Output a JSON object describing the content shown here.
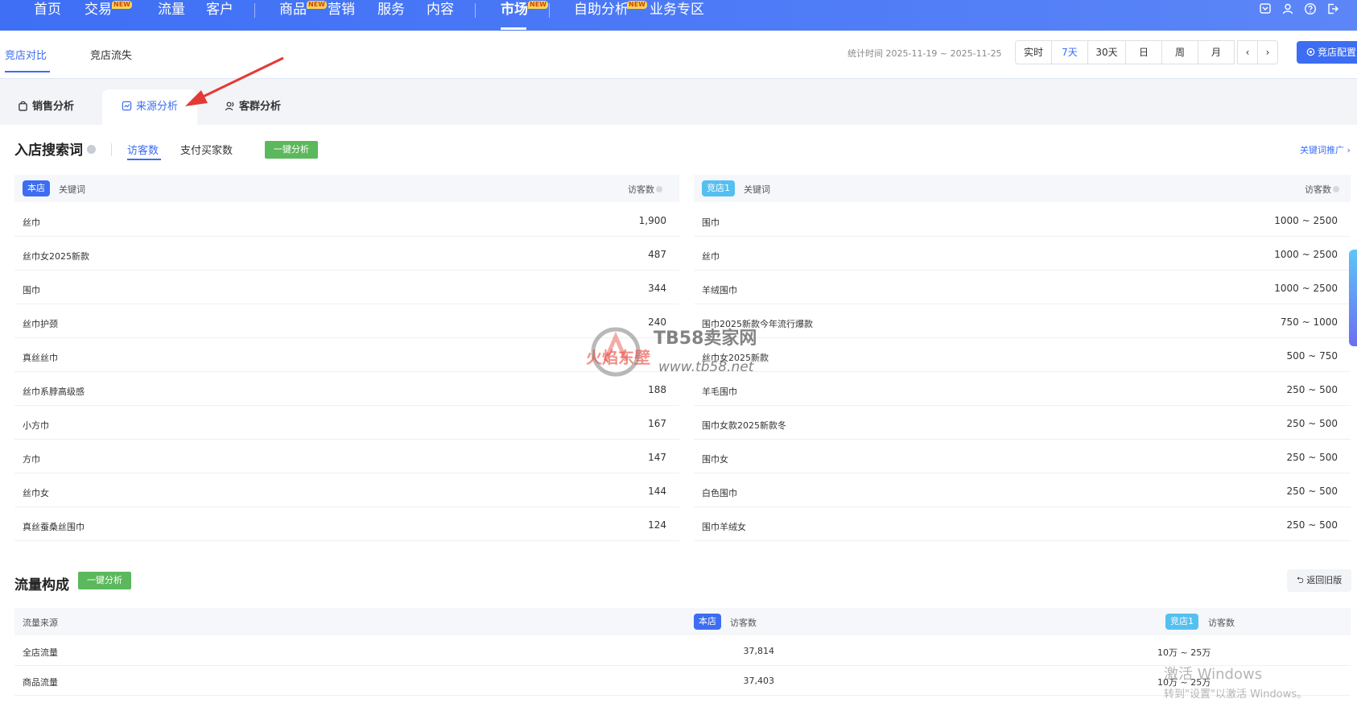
{
  "nav": {
    "items": [
      {
        "label": "首页",
        "new": false
      },
      {
        "label": "交易",
        "new": true
      },
      {
        "label": "流量",
        "new": false
      },
      {
        "label": "客户",
        "new": false
      },
      {
        "label": "商品",
        "new": true
      },
      {
        "label": "营销",
        "new": false
      },
      {
        "label": "服务",
        "new": false
      },
      {
        "label": "内容",
        "new": false
      },
      {
        "label": "市场",
        "new": true
      },
      {
        "label": "自助分析",
        "new": true
      },
      {
        "label": "业务专区",
        "new": false
      }
    ],
    "new_tag": "NEW",
    "active": "市场",
    "icons": [
      "message-icon",
      "user-icon",
      "help-icon",
      "exit-icon"
    ]
  },
  "subheader": {
    "tabs": [
      "竞店对比",
      "竞店流失"
    ],
    "stat_time": "统计时间 2025-11-19 ~ 2025-11-25",
    "ranges": [
      "实时",
      "7天",
      "30天",
      "日",
      "周",
      "月"
    ],
    "active_range": "7天",
    "prev": "‹",
    "next": "›",
    "config_button": "竞店配置"
  },
  "analysis_tabs": [
    "销售分析",
    "来源分析",
    "客群分析"
  ],
  "keywords": {
    "title": "入店搜索词",
    "metric_tabs": [
      "访客数",
      "支付买家数"
    ],
    "analyze_button": "一键分析",
    "promo_link": "关键词推广",
    "own": {
      "badge": "本店",
      "col_keyword": "关键词",
      "col_value": "访客数",
      "rows": [
        {
          "keyword": "丝巾",
          "value": "1,900"
        },
        {
          "keyword": "丝巾女2025新款",
          "value": "487"
        },
        {
          "keyword": "围巾",
          "value": "344"
        },
        {
          "keyword": "丝巾护颈",
          "value": "240"
        },
        {
          "keyword": "真丝丝巾",
          "value": ""
        },
        {
          "keyword": "丝巾系脖高级感",
          "value": "188"
        },
        {
          "keyword": "小方巾",
          "value": "167"
        },
        {
          "keyword": "方巾",
          "value": "147"
        },
        {
          "keyword": "丝巾女",
          "value": "144"
        },
        {
          "keyword": "真丝蚕桑丝围巾",
          "value": "124"
        }
      ]
    },
    "competitor": {
      "badge": "竞店1",
      "col_keyword": "关键词",
      "col_value": "访客数",
      "rows": [
        {
          "keyword": "围巾",
          "value": "1000 ~ 2500"
        },
        {
          "keyword": "丝巾",
          "value": "1000 ~ 2500"
        },
        {
          "keyword": "羊绒围巾",
          "value": "1000 ~ 2500"
        },
        {
          "keyword": "围巾2025新款今年流行爆款",
          "value": "750 ~ 1000"
        },
        {
          "keyword": "丝巾女2025新款",
          "value": "500 ~ 750"
        },
        {
          "keyword": "羊毛围巾",
          "value": "250 ~ 500"
        },
        {
          "keyword": "围巾女款2025新款冬",
          "value": "250 ~ 500"
        },
        {
          "keyword": "围巾女",
          "value": "250 ~ 500"
        },
        {
          "keyword": "白色围巾",
          "value": "250 ~ 500"
        },
        {
          "keyword": "围巾羊绒女",
          "value": "250 ~ 500"
        }
      ]
    }
  },
  "traffic": {
    "title": "流量构成",
    "analyze_button": "一键分析",
    "back_button": "返回旧版",
    "col_source": "流量来源",
    "own_badge": "本店",
    "own_col": "访客数",
    "comp_badge": "竞店1",
    "comp_col": "访客数",
    "rows": [
      {
        "source": "全店流量",
        "own": "37,814",
        "comp": "10万 ~ 25万"
      },
      {
        "source": "商品流量",
        "own": "37,403",
        "comp": "10万 ~ 25万"
      }
    ]
  },
  "overlay": {
    "tb58_title": "TB58卖家网",
    "tb58_url": "www.tb58.net",
    "tb58_red": "火焰东壁",
    "windows_line1": "激活 Windows",
    "windows_line2": "转到\"设置\"以激活 Windows。"
  },
  "colors": {
    "primary": "#3d6df2",
    "green": "#5cb85c",
    "competitor": "#55c0f0",
    "annotation": "#e53935"
  }
}
